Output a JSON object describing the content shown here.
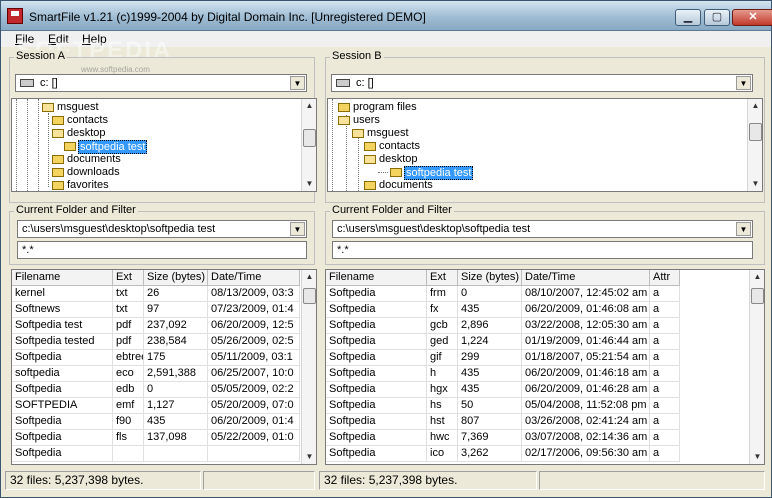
{
  "window": {
    "title": "SmartFile v1.21   (c)1999-2004 by Digital Domain Inc. [Unregistered DEMO]",
    "minimize": "▁",
    "maximize": "▢",
    "close": "✕"
  },
  "watermark": {
    "text": "SOFTPEDIA",
    "sub": "www.softpedia.com"
  },
  "menu": [
    {
      "label": "File",
      "mnemonic": "F",
      "rest": "ile"
    },
    {
      "label": "Edit",
      "mnemonic": "E",
      "rest": "dit"
    },
    {
      "label": "Help",
      "mnemonic": "H",
      "rest": "elp"
    }
  ],
  "sessions": [
    {
      "label": "Session A",
      "drive": "c: []",
      "tree": [
        {
          "label": "msguest",
          "depth": 0,
          "open": true
        },
        {
          "label": "contacts",
          "depth": 1,
          "open": false
        },
        {
          "label": "desktop",
          "depth": 1,
          "open": true
        },
        {
          "label": "softpedia test",
          "depth": 2,
          "open": false,
          "selected": true
        },
        {
          "label": "documents",
          "depth": 1,
          "open": false
        },
        {
          "label": "downloads",
          "depth": 1,
          "open": false
        },
        {
          "label": "favorites",
          "depth": 1,
          "open": false
        }
      ],
      "filter_label": "Current Folder and Filter",
      "folder": "c:\\users\\msguest\\desktop\\softpedia test",
      "filter": "*.*",
      "columns": [
        "Filename",
        "Ext",
        "Size (bytes)",
        "Date/Time"
      ],
      "rows": [
        [
          "kernel",
          "txt",
          "26",
          "08/13/2009, 03:3"
        ],
        [
          "Softnews",
          "txt",
          "97",
          "07/23/2009, 01:4"
        ],
        [
          "Softpedia test",
          "pdf",
          "237,092",
          "06/20/2009, 12:5"
        ],
        [
          "Softpedia tested",
          "pdf",
          "238,584",
          "05/26/2009, 02:5"
        ],
        [
          "Softpedia",
          "ebtree",
          "175",
          "05/11/2009, 03:1"
        ],
        [
          "softpedia",
          "eco",
          "2,591,388",
          "06/25/2007, 10:0"
        ],
        [
          "Softpedia",
          "edb",
          "0",
          "05/05/2009, 02:2"
        ],
        [
          "SOFTPEDIA",
          "emf",
          "1,127",
          "05/20/2009, 07:0"
        ],
        [
          "Softpedia",
          "f90",
          "435",
          "06/20/2009, 01:4"
        ],
        [
          "Softpedia",
          "fls",
          "137,098",
          "05/22/2009, 01:0"
        ],
        [
          "Softpedia",
          "",
          "",
          ""
        ]
      ],
      "status": "32 files: 5,237,398 bytes."
    },
    {
      "label": "Session B",
      "drive": "c: []",
      "tree": [
        {
          "label": "program files",
          "depth": 0,
          "open": false
        },
        {
          "label": "users",
          "depth": 0,
          "open": true
        },
        {
          "label": "msguest",
          "depth": 1,
          "open": true
        },
        {
          "label": "contacts",
          "depth": 2,
          "open": false
        },
        {
          "label": "desktop",
          "depth": 2,
          "open": true
        },
        {
          "label": "softpedia test",
          "depth": 3,
          "open": false,
          "selected": true
        },
        {
          "label": "documents",
          "depth": 2,
          "open": false
        }
      ],
      "filter_label": "Current Folder and Filter",
      "folder": "c:\\users\\msguest\\desktop\\softpedia test",
      "filter": "*.*",
      "columns": [
        "Filename",
        "Ext",
        "Size (bytes)",
        "Date/Time",
        "Attr"
      ],
      "rows": [
        [
          "Softpedia",
          "frm",
          "0",
          "08/10/2007, 12:45:02 am",
          "a"
        ],
        [
          "Softpedia",
          "fx",
          "435",
          "06/20/2009, 01:46:08 am",
          "a"
        ],
        [
          "Softpedia",
          "gcb",
          "2,896",
          "03/22/2008, 12:05:30 am",
          "a"
        ],
        [
          "Softpedia",
          "ged",
          "1,224",
          "01/19/2009, 01:46:44 am",
          "a"
        ],
        [
          "Softpedia",
          "gif",
          "299",
          "01/18/2007, 05:21:54 am",
          "a"
        ],
        [
          "Softpedia",
          "h",
          "435",
          "06/20/2009, 01:46:18 am",
          "a"
        ],
        [
          "Softpedia",
          "hgx",
          "435",
          "06/20/2009, 01:46:28 am",
          "a"
        ],
        [
          "Softpedia",
          "hs",
          "50",
          "05/04/2008, 11:52:08 pm",
          "a"
        ],
        [
          "Softpedia",
          "hst",
          "807",
          "03/26/2008, 02:41:24 am",
          "a"
        ],
        [
          "Softpedia",
          "hwc",
          "7,369",
          "03/07/2008, 02:14:36 am",
          "a"
        ],
        [
          "Softpedia",
          "ico",
          "3,262",
          "02/17/2006, 09:56:30 am",
          "a"
        ]
      ],
      "status": "32 files: 5,237,398 bytes."
    }
  ]
}
